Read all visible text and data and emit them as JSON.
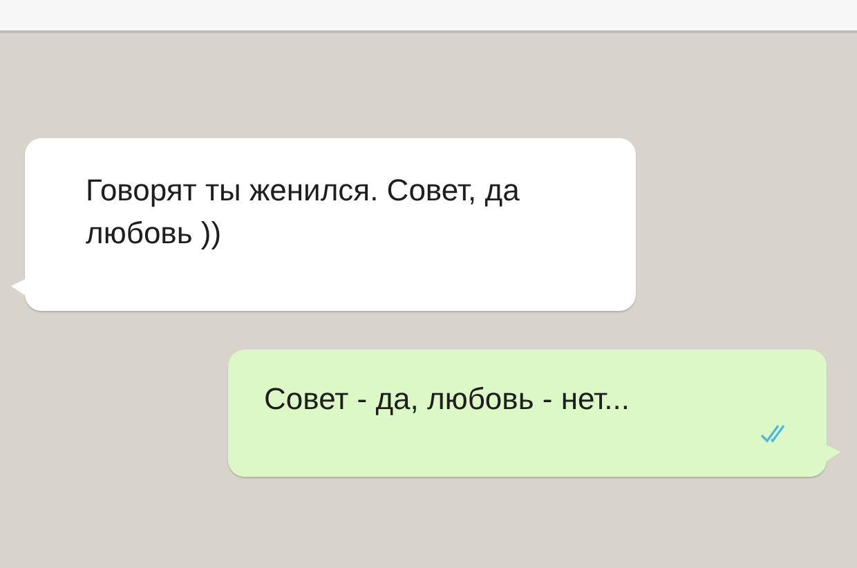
{
  "messages": [
    {
      "outgoing": false,
      "text": "Говорят ты женился. Совет, да любовь ))"
    },
    {
      "outgoing": true,
      "text": "Совет - да, любовь - нет...",
      "read": true
    }
  ]
}
